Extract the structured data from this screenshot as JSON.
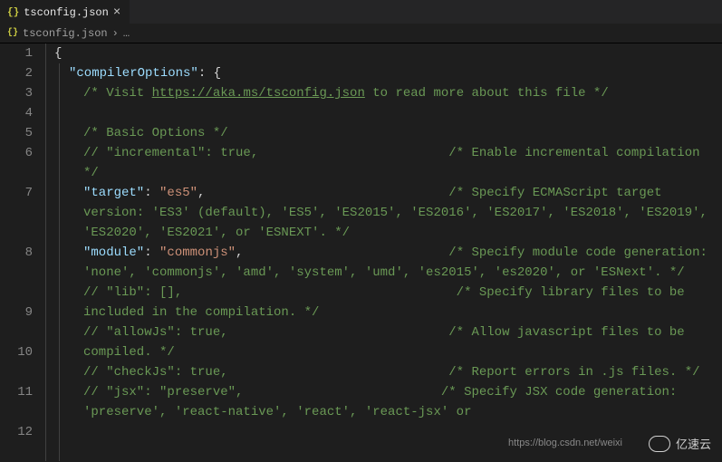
{
  "tab": {
    "icon": "{}",
    "filename": "tsconfig.json",
    "close": "×"
  },
  "breadcrumb": {
    "icon": "{}",
    "filename": "tsconfig.json",
    "sep": "›",
    "more": "…"
  },
  "gutter": [
    "1",
    "2",
    "3",
    "4",
    "5",
    "6",
    "7",
    "8",
    "9",
    "10",
    "11",
    "12"
  ],
  "code": {
    "l1": "{",
    "l2_key": "\"compilerOptions\"",
    "l2_colon": ": ",
    "l2_brace": "{",
    "l3_pre": "/* Visit ",
    "l3_link": "https://aka.ms/tsconfig.json",
    "l3_post": " to read more about this file */",
    "l5": "/* Basic Options */",
    "l6": "// \"incremental\": true,                         /* Enable incremental compilation */",
    "l7_key": "\"target\"",
    "l7_colon": ": ",
    "l7_val": "\"es5\"",
    "l7_comma": ",",
    "l7_com": "                                /* Specify ECMAScript target version: 'ES3' (default), 'ES5', 'ES2015', 'ES2016', 'ES2017', 'ES2018', 'ES2019', 'ES2020', 'ES2021', or 'ESNEXT'. */",
    "l8_key": "\"module\"",
    "l8_colon": ": ",
    "l8_val": "\"commonjs\"",
    "l8_comma": ",",
    "l8_com": "                           /* Specify module code generation: 'none', 'commonjs', 'amd', 'system', 'umd', 'es2015', 'es2020', or 'ESNext'. */",
    "l9": "// \"lib\": [],                                    /* Specify library files to be included in the compilation. */",
    "l10": "// \"allowJs\": true,                             /* Allow javascript files to be compiled. */",
    "l11": "// \"checkJs\": true,                             /* Report errors in .js files. */",
    "l12": "// \"jsx\": \"preserve\",                          /* Specify JSX code generation: 'preserve', 'react-native', 'react', 'react-jsx' or"
  },
  "watermark": {
    "csdn": "https://blog.csdn.net/weixi",
    "brand": "亿速云"
  }
}
